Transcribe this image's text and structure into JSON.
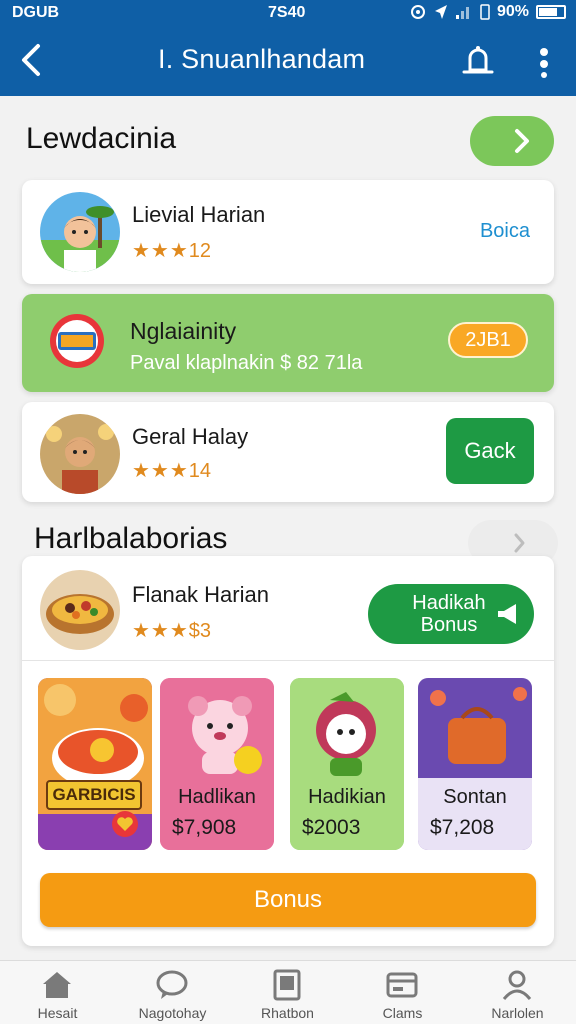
{
  "status_bar": {
    "left": "DGUB",
    "time": "7S40",
    "battery": "90%"
  },
  "app_bar": {
    "title": "I. Snuanlhandam"
  },
  "section1": {
    "title": "Lewdacinia"
  },
  "cards": [
    {
      "name": "Lievial Harian",
      "stars": "★★★",
      "rating": "12",
      "action": "Boica"
    },
    {
      "name": "Nglaiainity",
      "subtitle": "Paval klaplnakin $ 82 71la",
      "badge": "2JB1"
    },
    {
      "name": "Geral Halay",
      "stars": "★★★",
      "rating": "14",
      "action": "Gack"
    }
  ],
  "section2": {
    "title": "Harlbalaborias"
  },
  "featured": {
    "name": "Flanak Harian",
    "stars": "★★★",
    "rating": "$3",
    "button": "Hadikah Bonus"
  },
  "tiles": [
    {
      "label": "GARBICIS",
      "bg": "#8a3fb0"
    },
    {
      "label": "Hadlikan",
      "price": "$7,908",
      "bg": "#e8709a"
    },
    {
      "label": "Hadikian",
      "price": "$2003",
      "bg": "#8fd06a"
    },
    {
      "label": "Sontan",
      "price": "$7,208",
      "bg": "#7b4fb8"
    }
  ],
  "bonus_button": "Bonus",
  "bottom_nav": [
    {
      "label": "Hesait",
      "icon": "home-icon"
    },
    {
      "label": "Nagotohay",
      "icon": "chat-icon"
    },
    {
      "label": "Rhatbon",
      "icon": "book-icon"
    },
    {
      "label": "Clams",
      "icon": "card-icon"
    },
    {
      "label": "Narlolen",
      "icon": "profile-icon"
    }
  ],
  "colors": {
    "primary": "#0f5fa6",
    "green": "#1e9a44",
    "light_green": "#8fcd6e",
    "orange": "#f59b12",
    "link": "#1e8fd0"
  }
}
